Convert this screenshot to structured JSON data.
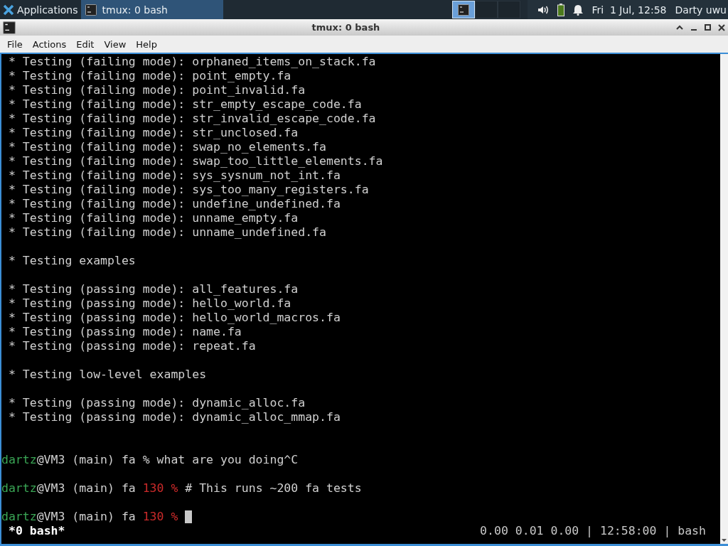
{
  "panel": {
    "menu_label": "Applications",
    "tasks": [
      {
        "label": "tmux: 0 bash",
        "selected": true
      }
    ],
    "workspaces": [
      {
        "selected": true
      },
      {
        "selected": false
      },
      {
        "selected": false
      }
    ],
    "clock": "Fri  1 Jul, 12:58",
    "user": "Darty uwu"
  },
  "window": {
    "title": "tmux: 0 bash"
  },
  "menu": [
    "File",
    "Actions",
    "Edit",
    "View",
    "Help"
  ],
  "terminal": {
    "lines": [
      {
        "segments": [
          {
            "kind": "text",
            "text": " * Testing (failing mode): orphaned_items_on_stack.fa"
          }
        ]
      },
      {
        "segments": [
          {
            "kind": "text",
            "text": " * Testing (failing mode): point_empty.fa"
          }
        ]
      },
      {
        "segments": [
          {
            "kind": "text",
            "text": " * Testing (failing mode): point_invalid.fa"
          }
        ]
      },
      {
        "segments": [
          {
            "kind": "text",
            "text": " * Testing (failing mode): str_empty_escape_code.fa"
          }
        ]
      },
      {
        "segments": [
          {
            "kind": "text",
            "text": " * Testing (failing mode): str_invalid_escape_code.fa"
          }
        ]
      },
      {
        "segments": [
          {
            "kind": "text",
            "text": " * Testing (failing mode): str_unclosed.fa"
          }
        ]
      },
      {
        "segments": [
          {
            "kind": "text",
            "text": " * Testing (failing mode): swap_no_elements.fa"
          }
        ]
      },
      {
        "segments": [
          {
            "kind": "text",
            "text": " * Testing (failing mode): swap_too_little_elements.fa"
          }
        ]
      },
      {
        "segments": [
          {
            "kind": "text",
            "text": " * Testing (failing mode): sys_sysnum_not_int.fa"
          }
        ]
      },
      {
        "segments": [
          {
            "kind": "text",
            "text": " * Testing (failing mode): sys_too_many_registers.fa"
          }
        ]
      },
      {
        "segments": [
          {
            "kind": "text",
            "text": " * Testing (failing mode): undefine_undefined.fa"
          }
        ]
      },
      {
        "segments": [
          {
            "kind": "text",
            "text": " * Testing (failing mode): unname_empty.fa"
          }
        ]
      },
      {
        "segments": [
          {
            "kind": "text",
            "text": " * Testing (failing mode): unname_undefined.fa"
          }
        ]
      },
      {
        "kind": "blank"
      },
      {
        "segments": [
          {
            "kind": "text",
            "text": " * Testing examples"
          }
        ]
      },
      {
        "kind": "blank"
      },
      {
        "segments": [
          {
            "kind": "text",
            "text": " * Testing (passing mode): all_features.fa"
          }
        ]
      },
      {
        "segments": [
          {
            "kind": "text",
            "text": " * Testing (passing mode): hello_world.fa"
          }
        ]
      },
      {
        "segments": [
          {
            "kind": "text",
            "text": " * Testing (passing mode): hello_world_macros.fa"
          }
        ]
      },
      {
        "segments": [
          {
            "kind": "text",
            "text": " * Testing (passing mode): name.fa"
          }
        ]
      },
      {
        "segments": [
          {
            "kind": "text",
            "text": " * Testing (passing mode): repeat.fa"
          }
        ]
      },
      {
        "kind": "blank"
      },
      {
        "segments": [
          {
            "kind": "text",
            "text": " * Testing low-level examples"
          }
        ]
      },
      {
        "kind": "blank"
      },
      {
        "segments": [
          {
            "kind": "text",
            "text": " * Testing (passing mode): dynamic_alloc.fa"
          }
        ]
      },
      {
        "segments": [
          {
            "kind": "text",
            "text": " * Testing (passing mode): dynamic_alloc_mmap.fa"
          }
        ]
      },
      {
        "kind": "blank"
      },
      {
        "kind": "blank"
      },
      {
        "segments": [
          {
            "kind": "user",
            "text": "dartz"
          },
          {
            "kind": "text",
            "text": "@VM3 (main) fa % what are you doing^C"
          }
        ]
      },
      {
        "kind": "blank"
      },
      {
        "segments": [
          {
            "kind": "user",
            "text": "dartz"
          },
          {
            "kind": "text",
            "text": "@VM3 (main) fa "
          },
          {
            "kind": "error",
            "text": "130 %"
          },
          {
            "kind": "text",
            "text": " # This runs ~200 fa tests"
          }
        ]
      },
      {
        "kind": "blank"
      },
      {
        "cursor": true,
        "segments": [
          {
            "kind": "user",
            "text": "dartz"
          },
          {
            "kind": "text",
            "text": "@VM3 (main) fa "
          },
          {
            "kind": "error",
            "text": "130 %"
          }
        ]
      }
    ],
    "status_left": "*0 bash*",
    "status_right": "0.00 0.01 0.00 | 12:58:00 | bash"
  }
}
